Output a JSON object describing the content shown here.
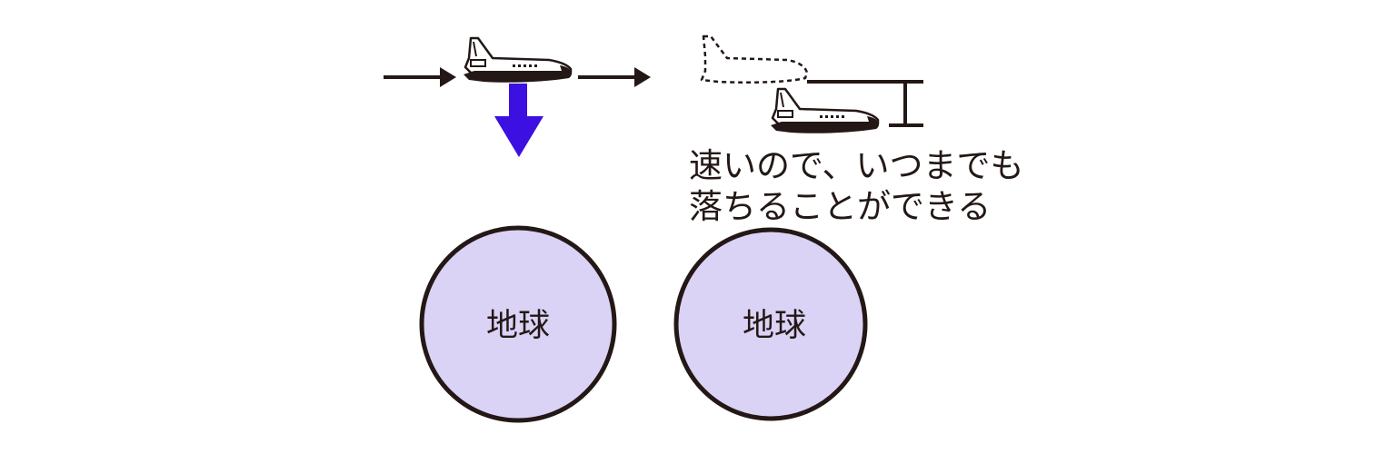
{
  "colors": {
    "ink": "#231815",
    "earth_fill": "#dad3f6",
    "gravity_arrow": "#3b10e0",
    "background": "#ffffff"
  },
  "icons": {
    "shuttle": "space-shuttle-icon",
    "shuttle_ghost": "dashed-shuttle-outline-icon"
  },
  "left_panel": {
    "earth_label": "地球"
  },
  "right_panel": {
    "earth_label": "地球",
    "caption_line1": "速いので、いつまでも",
    "caption_line2": "落ちることができる"
  }
}
